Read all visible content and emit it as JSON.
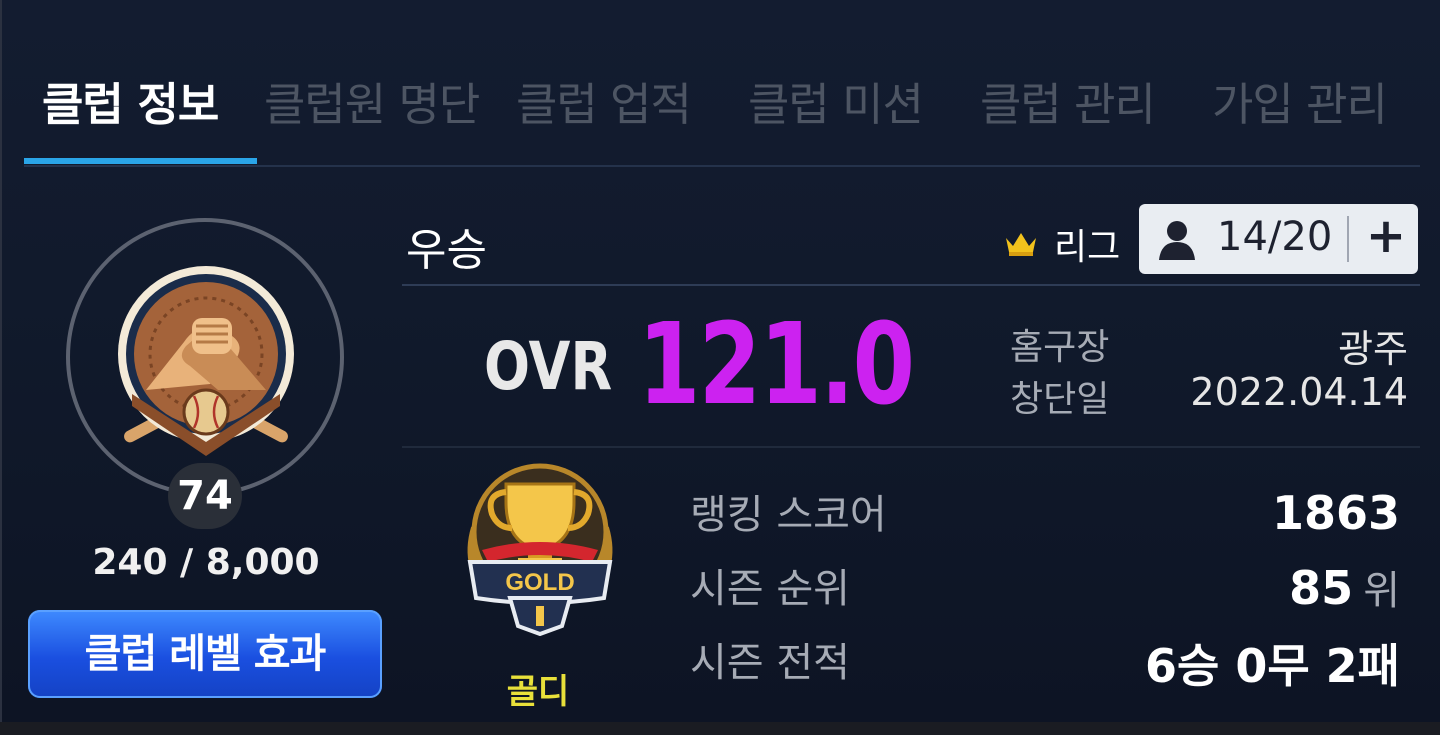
{
  "tabs": [
    {
      "label": "클럽 정보",
      "active": true
    },
    {
      "label": "클럽원 명단",
      "active": false
    },
    {
      "label": "클럽 업적",
      "active": false
    },
    {
      "label": "클럽 미션",
      "active": false
    },
    {
      "label": "클럽 관리",
      "active": false
    },
    {
      "label": "가입 관리",
      "active": false
    }
  ],
  "club": {
    "name": "우승",
    "level": "74",
    "xp": "240 / 8,000",
    "xp_progress": 0.03,
    "level_effect_button": "클럽 레벨 효과",
    "league_label": "리그",
    "members": "14/20",
    "add_member": "+",
    "ovr_label": "OVR",
    "ovr_value": "121.0",
    "home_label": "홈구장",
    "home_value": "광주",
    "founded_label": "창단일",
    "founded_value": "2022.04.14",
    "tier_name": "골디",
    "tier_badge_text": "GOLD",
    "ranking_score_label": "랭킹 스코어",
    "ranking_score_value": "1863",
    "season_rank_label": "시즌 순위",
    "season_rank_value": "85",
    "season_rank_unit": "위",
    "season_record_label": "시즌 전적",
    "season_record_value": "6승 0무 2패"
  },
  "colors": {
    "accent_tab": "#2aa5e8",
    "ovr": "#cc22f0",
    "tier_name": "#e8e03a",
    "button_blue": "#1a4fe0"
  },
  "icons": {
    "crown": "crown-icon",
    "member": "person-icon",
    "emblem": "arm-wrestling-baseball-emblem",
    "trophy": "gold-trophy-icon"
  }
}
